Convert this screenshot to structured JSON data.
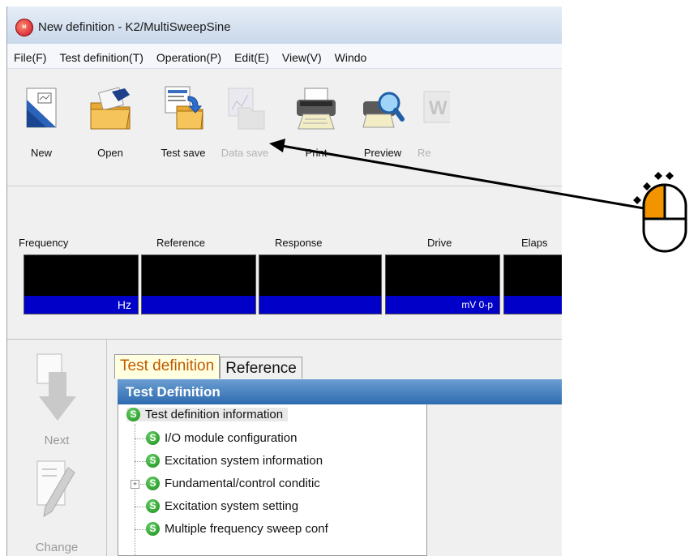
{
  "window": {
    "title": "New definition - K2/MultiSweepSine",
    "app_icon_text": "MULTI SWEEP"
  },
  "menu": [
    "File(F)",
    "Test definition(T)",
    "Operation(P)",
    "Edit(E)",
    "View(V)",
    "Windo"
  ],
  "toolbar": {
    "buttons": [
      {
        "label": "New",
        "icon": "new-document-icon",
        "enabled": true
      },
      {
        "label": "Open",
        "icon": "open-folder-icon",
        "enabled": true
      },
      {
        "label": "Test save",
        "icon": "test-save-icon",
        "enabled": true
      },
      {
        "label": "Data save",
        "icon": "data-save-icon",
        "enabled": false
      },
      {
        "label": "Print",
        "icon": "printer-icon",
        "enabled": true
      },
      {
        "label": "Preview",
        "icon": "preview-icon",
        "enabled": true
      },
      {
        "label": "Re",
        "icon": "report-icon",
        "enabled": false
      }
    ]
  },
  "monitor": {
    "meters": [
      {
        "label": "Frequency",
        "unit": "Hz"
      },
      {
        "label": "Reference",
        "unit": ""
      },
      {
        "label": "Response",
        "unit": ""
      },
      {
        "label": "Drive",
        "unit": "mV 0-p"
      },
      {
        "label": "Elaps",
        "unit": ""
      }
    ]
  },
  "side_panel": {
    "items": [
      {
        "label": "Next",
        "icon": "next-arrow-icon"
      },
      {
        "label": "Change",
        "icon": "change-pen-icon"
      }
    ]
  },
  "tabs": [
    {
      "label": "Test definition",
      "active": true
    },
    {
      "label": "Reference",
      "active": false
    }
  ],
  "panel_title": "Test Definition",
  "tree": {
    "root": "Test definition information",
    "children": [
      "I/O module configuration",
      "Excitation system information",
      "Fundamental/control conditic",
      "Excitation system setting",
      "Multiple frequency sweep conf"
    ],
    "expandable_index": 2
  },
  "annotation": {
    "icon": "mouse-left-click-icon",
    "accent": "#f29400"
  }
}
